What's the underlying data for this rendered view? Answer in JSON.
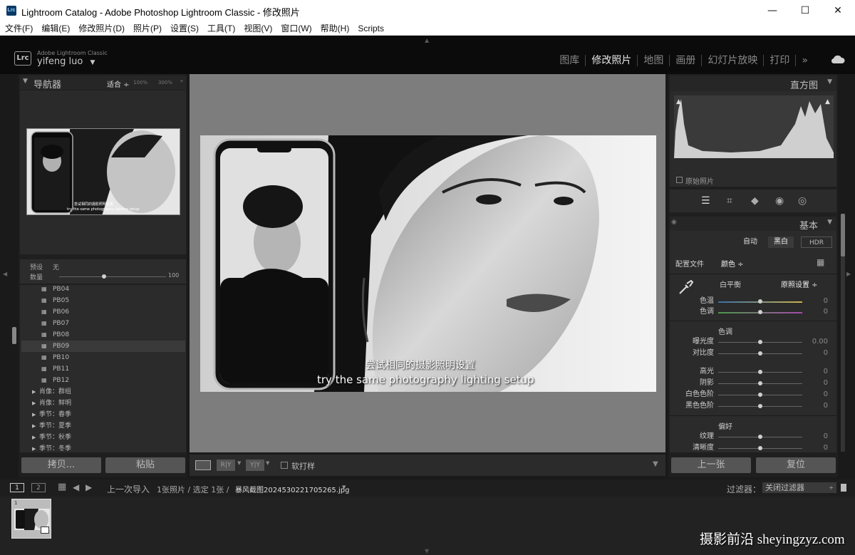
{
  "window": {
    "app_icon": "Lrc",
    "title": "Lightroom Catalog - Adobe Photoshop Lightroom Classic - 修改照片",
    "minimize": "—",
    "maximize": "☐",
    "close": "✕"
  },
  "menu": [
    "文件(F)",
    "编辑(E)",
    "修改照片(D)",
    "照片(P)",
    "设置(S)",
    "工具(T)",
    "视图(V)",
    "窗口(W)",
    "帮助(H)",
    "Scripts"
  ],
  "header": {
    "badge": "Lrc",
    "brand": "Adobe Lightroom Classic",
    "user": "yifeng luo",
    "user_arrow": "▼",
    "modules": [
      "图库",
      "修改照片",
      "地图",
      "画册",
      "幻灯片放映",
      "打印"
    ],
    "active_module": "修改照片",
    "more": "»"
  },
  "navigator": {
    "title": "导航器",
    "zoom_fit": "适合 ÷",
    "zoom_100": "100%",
    "zoom_300": "300%",
    "thumb_caption": "尝试相同的摄影照明设置",
    "thumb_caption_en": "try the same photography lighting setup"
  },
  "presets": {
    "preview_label": "预设",
    "preview_value": "无",
    "amount_label": "数量",
    "amount_value": "100",
    "items": [
      "PB04",
      "PB05",
      "PB06",
      "PB07",
      "PB08",
      "PB09",
      "PB10",
      "PB11",
      "PB12"
    ],
    "selected": "PB09",
    "groups": [
      "肖像：群组",
      "肖像：鲜明",
      "季节：春季",
      "季节：夏季",
      "季节：秋季",
      "季节：冬季"
    ],
    "copy_button": "拷贝...",
    "paste_button": "粘贴"
  },
  "photo": {
    "caption_cn": "尝试相同的摄影照明设置",
    "caption_en": "try the same photography lighting setup"
  },
  "toolbar": {
    "view_ry": "R|Y",
    "view_yy": "Y|Y",
    "softproof_label": "软打样",
    "dropdown": "▼"
  },
  "histogram": {
    "title": "直方图",
    "original_label": "原始照片"
  },
  "basic": {
    "title": "基本",
    "auto": "自动",
    "bw": "黑白",
    "hdr": "HDR",
    "profile_label": "配置文件",
    "profile_value": "颜色 ÷",
    "wb_label": "白平衡",
    "wb_value": "原照设置 ÷",
    "tone_section": "色调",
    "presence_section": "偏好",
    "sliders": [
      {
        "label": "色温",
        "value": "0"
      },
      {
        "label": "色调",
        "value": "0"
      },
      {
        "label": "曝光度",
        "value": "0.00"
      },
      {
        "label": "对比度",
        "value": "0"
      },
      {
        "label": "高光",
        "value": "0"
      },
      {
        "label": "阴影",
        "value": "0"
      },
      {
        "label": "白色色阶",
        "value": "0"
      },
      {
        "label": "黑色色阶",
        "value": "0"
      },
      {
        "label": "纹理",
        "value": "0"
      },
      {
        "label": "清晰度",
        "value": "0"
      }
    ],
    "prev_button": "上一张",
    "reset_button": "复位"
  },
  "filmbar": {
    "screen1": "1",
    "screen2": "2",
    "path": "上一次导入",
    "count": "1张照片 / 选定 1张 / ",
    "filename": "暴风截图2024530221705265.jpg",
    "file_arrow": "▼",
    "filter_label": "过滤器：",
    "filter_value": "关闭过滤器",
    "thumb_index": "1"
  },
  "watermark": "摄影前沿 sheyingzyz.com",
  "colors": {
    "panel": "#313131",
    "panel_header": "#262626",
    "canvas": "#7d7d7d",
    "active_text": "#e6e6e6"
  }
}
